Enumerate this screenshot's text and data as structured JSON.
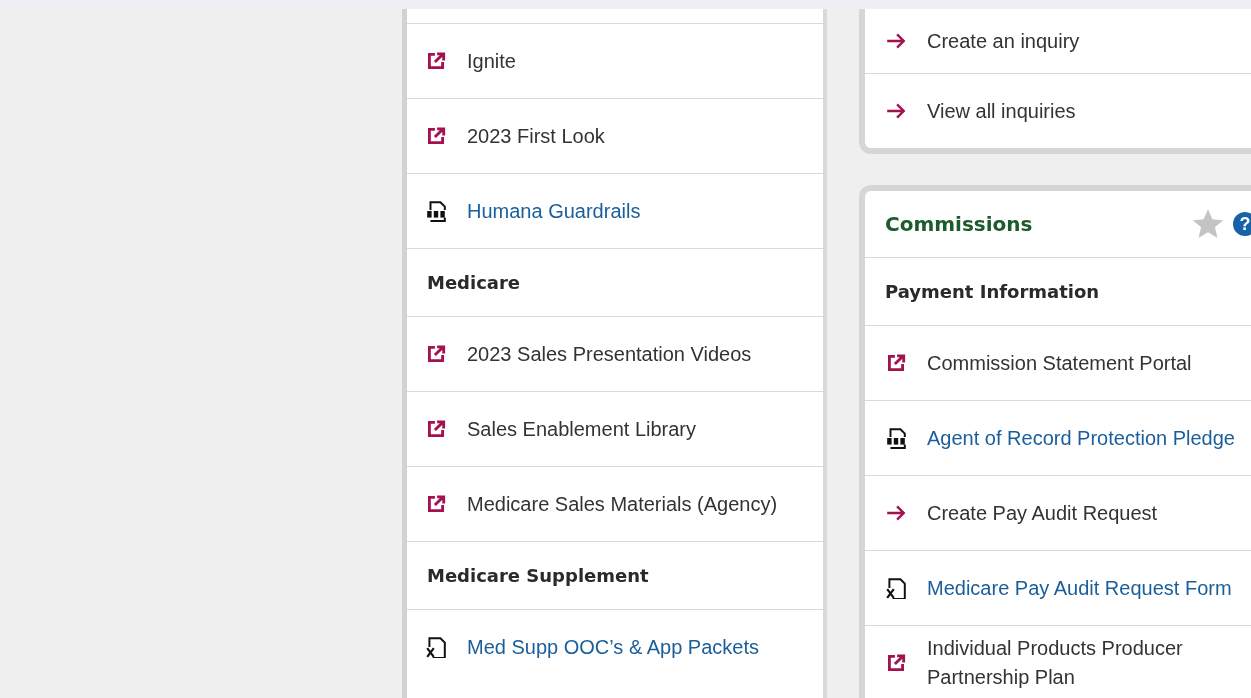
{
  "left_panel": {
    "items": [
      {
        "kind": "link",
        "label": "Ignite"
      },
      {
        "kind": "link",
        "label": "2023 First Look"
      },
      {
        "kind": "pdf",
        "label": "Humana Guardrails"
      },
      {
        "kind": "header",
        "label": "Medicare"
      },
      {
        "kind": "link",
        "label": "2023 Sales Presentation Videos"
      },
      {
        "kind": "link",
        "label": "Sales Enablement Library"
      },
      {
        "kind": "link",
        "label": "Medicare Sales Materials (Agency)"
      },
      {
        "kind": "header",
        "label": "Medicare Supplement"
      },
      {
        "kind": "excel",
        "label": "Med Supp OOC’s & App Packets"
      }
    ]
  },
  "inquiries_card": {
    "items": [
      {
        "kind": "arrow",
        "label": "Create an inquiry"
      },
      {
        "kind": "arrow",
        "label": "View all inquiries"
      }
    ]
  },
  "commissions_card": {
    "title": "Commissions",
    "starred": false,
    "help": "?",
    "items": [
      {
        "kind": "header",
        "label": "Payment Information"
      },
      {
        "kind": "link",
        "label": "Commission Statement Portal"
      },
      {
        "kind": "pdf",
        "label": "Agent of Record Protection Pledge"
      },
      {
        "kind": "arrow",
        "label": "Create Pay Audit Request"
      },
      {
        "kind": "excel",
        "label": "Medicare Pay Audit Request Form"
      },
      {
        "kind": "link",
        "label": "Individual Products Producer Partnership Plan"
      }
    ]
  }
}
